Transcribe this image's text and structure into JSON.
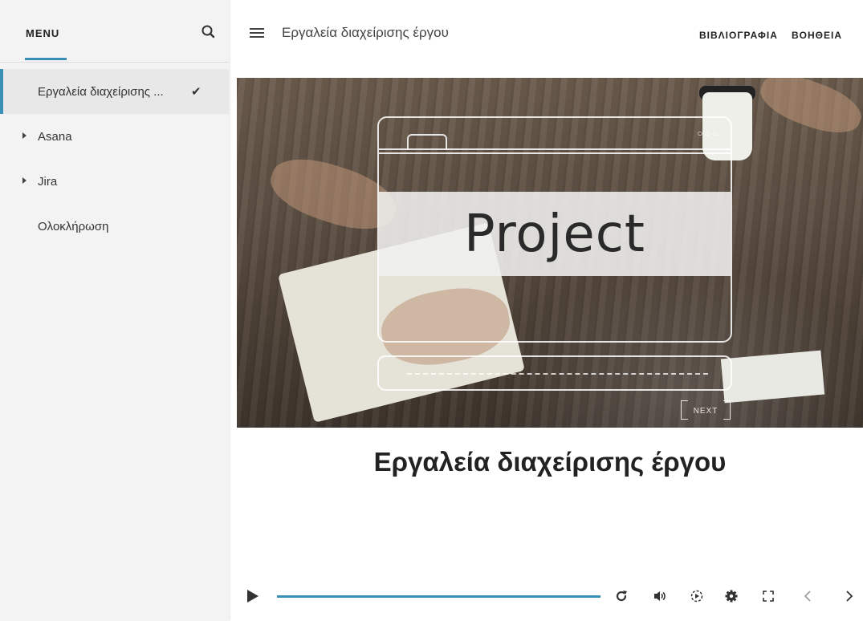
{
  "sidebar": {
    "menu_label": "MENU",
    "search_icon": "search-icon",
    "items": [
      {
        "label": "Εργαλεία διαχείρισης ...",
        "active": true,
        "completed": true,
        "expandable": false
      },
      {
        "label": "Asana",
        "active": false,
        "completed": false,
        "expandable": true
      },
      {
        "label": "Jira",
        "active": false,
        "completed": false,
        "expandable": true
      },
      {
        "label": "Ολοκλήρωση",
        "active": false,
        "completed": false,
        "expandable": false
      }
    ]
  },
  "header": {
    "menu_icon": "hamburger-icon",
    "title": "Εργαλεία διαχείρισης έργου",
    "links": [
      "ΒΙΒΛΙΟΓΡΑΦΙΑ",
      "ΒΟΗΘΕΙΑ"
    ]
  },
  "slide": {
    "image_text": "Project",
    "next_label": "NEXT",
    "title": "Εργαλεία διαχείρισης έργου"
  },
  "player": {
    "progress_fraction": 1.0,
    "icons": [
      "play-icon",
      "replay-icon",
      "volume-icon",
      "playback-speed-icon",
      "settings-icon",
      "fullscreen-icon",
      "previous-icon",
      "next-icon"
    ]
  },
  "colors": {
    "accent": "#3a8fb7",
    "sidebar_bg": "#f3f3f3",
    "active_item_bg": "#e8e8e8"
  }
}
